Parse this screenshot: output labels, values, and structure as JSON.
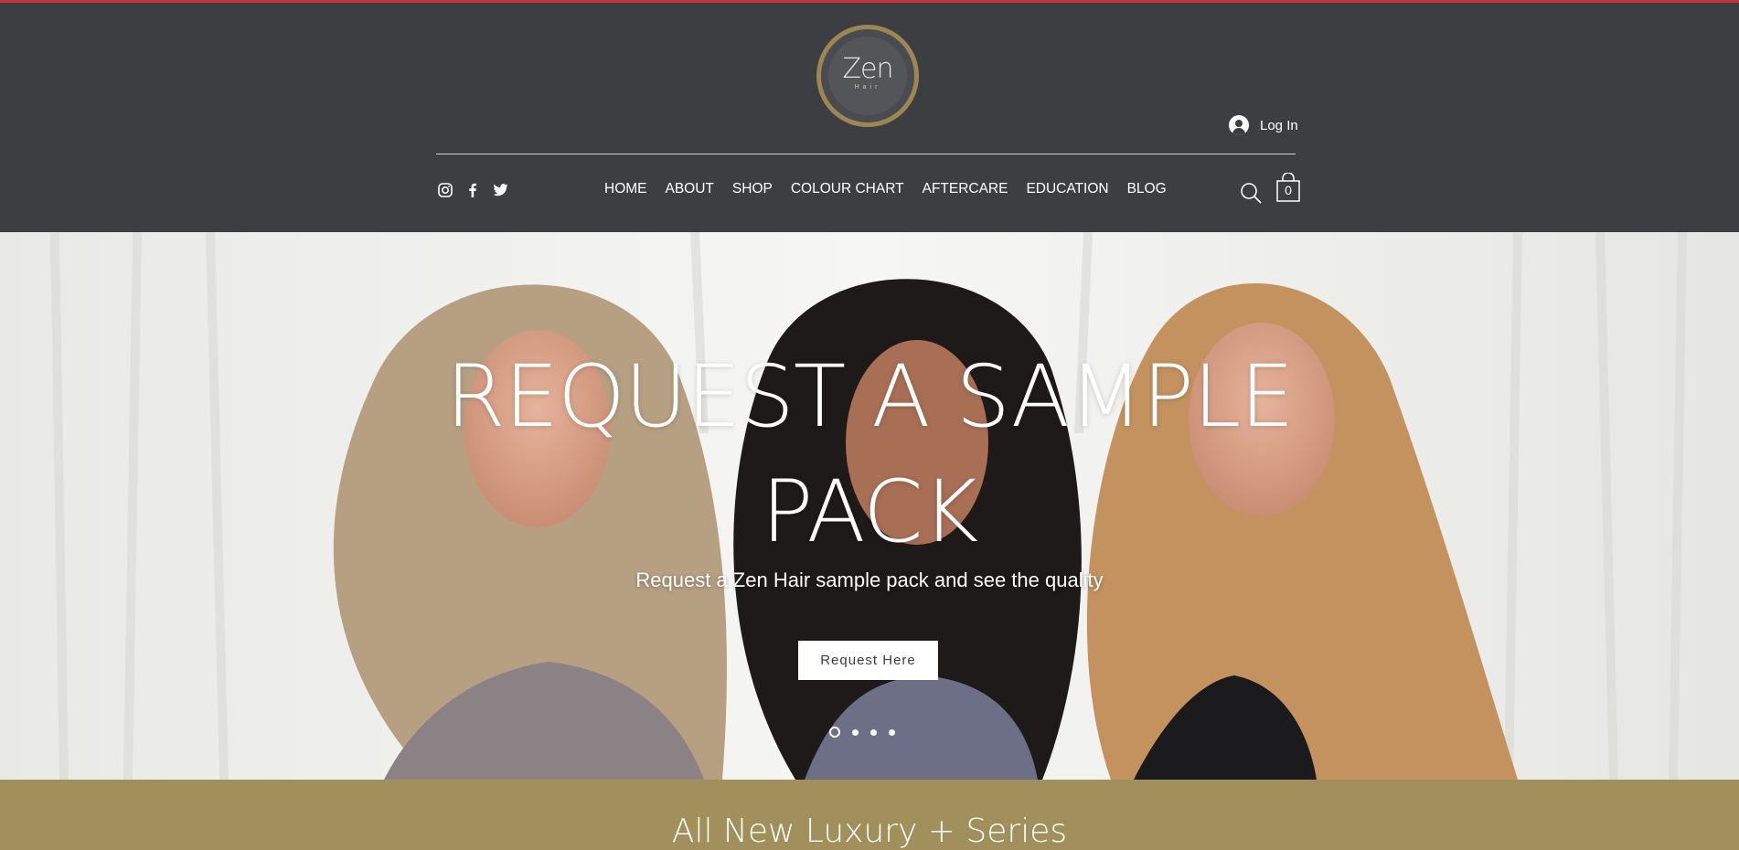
{
  "header": {
    "logo": {
      "word": "Zen",
      "sub": "Hair"
    },
    "login_label": "Log In",
    "nav": [
      {
        "label": "HOME"
      },
      {
        "label": "ABOUT"
      },
      {
        "label": "SHOP"
      },
      {
        "label": "COLOUR CHART"
      },
      {
        "label": "AFTERCARE"
      },
      {
        "label": "EDUCATION"
      },
      {
        "label": "BLOG"
      }
    ],
    "social": [
      "instagram-icon",
      "facebook-icon",
      "twitter-icon"
    ],
    "cart_count": "0"
  },
  "hero": {
    "title_line1": "REQUEST A SAMPLE",
    "title_line2": "PACK",
    "subtitle": "Request a Zen Hair sample pack and see the quality",
    "cta_label": "Request Here",
    "slides": 4,
    "active_slide": 1
  },
  "section": {
    "title": "All New Luxury + Series"
  },
  "colors": {
    "header_bg": "#3d3e42",
    "top_accent": "#c3323d",
    "logo_ring": "#9c8654",
    "section_bg": "#a1905c"
  }
}
